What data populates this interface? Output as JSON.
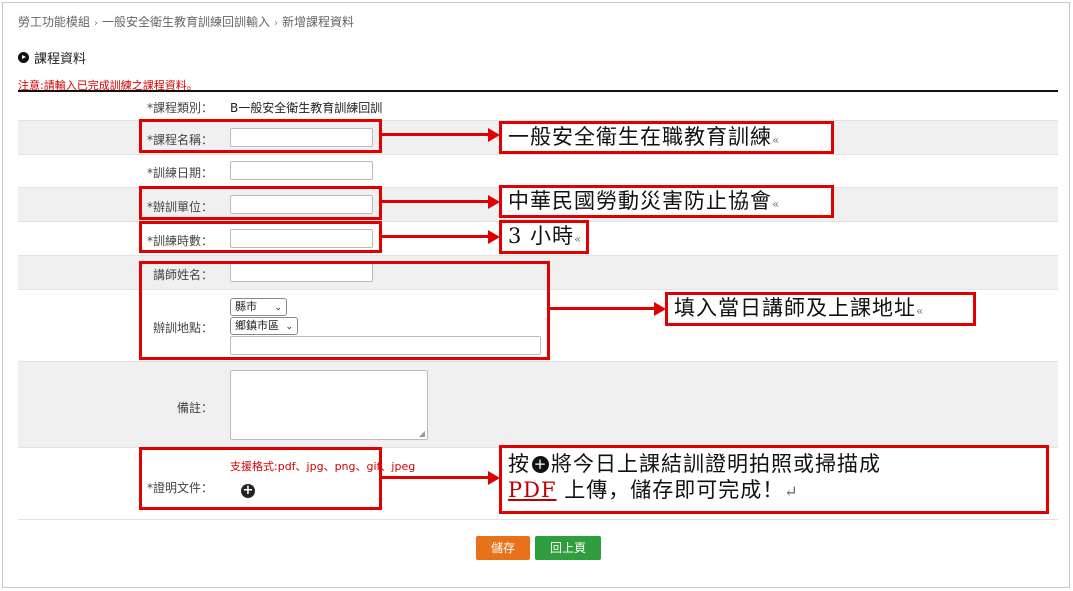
{
  "breadcrumb": [
    "勞工功能模組",
    "一般安全衛生教育訓練回訓輸入",
    "新增課程資料"
  ],
  "breadcrumb_separator": "›",
  "section_title": "課程資料",
  "notice": "注意:請輸入已完成訓練之課程資料。",
  "form": {
    "course_type_label": "*課程類別：",
    "course_type_value": "B一般安全衛生教育訓練回訓",
    "course_name_label": "*課程名稱：",
    "training_date_label": "*訓練日期：",
    "organizer_label": "*辦訓單位：",
    "hours_label": "*訓練時數：",
    "instructor_label": "講師姓名：",
    "location_label": "辦訓地點：",
    "county_select": "縣市",
    "district_select": "鄉鎮市區",
    "remarks_label": "備註：",
    "certificate_label": "*證明文件：",
    "supported_formats": "支援格式:pdf、jpg、png、gif、jpeg",
    "add_file_glyph": "+"
  },
  "buttons": {
    "save": "儲存",
    "back": "回上頁"
  },
  "annotations": {
    "course_name_example": "一般安全衛生在職教育訓練",
    "organizer_example": "中華民國勞動災害防止協會",
    "hours_example": "3 小時",
    "instructor_location_note": "填入當日講師及上課地址",
    "upload_line1_before": "按",
    "upload_line1_after": "將今日上課結訓證明拍照或掃描成",
    "upload_line2_pdf": "PDF",
    "upload_line2_rest": " 上傳，儲存即可完成！",
    "paragraph_mark": "↵",
    "end_mark": "«"
  },
  "colors": {
    "annotation_red": "#e00000",
    "notice_red": "#d40000",
    "save_orange": "#e8721c",
    "back_green": "#2e9e3e"
  },
  "icons": [
    "circle-play-icon",
    "circle-plus-icon",
    "select-caret-icon"
  ]
}
